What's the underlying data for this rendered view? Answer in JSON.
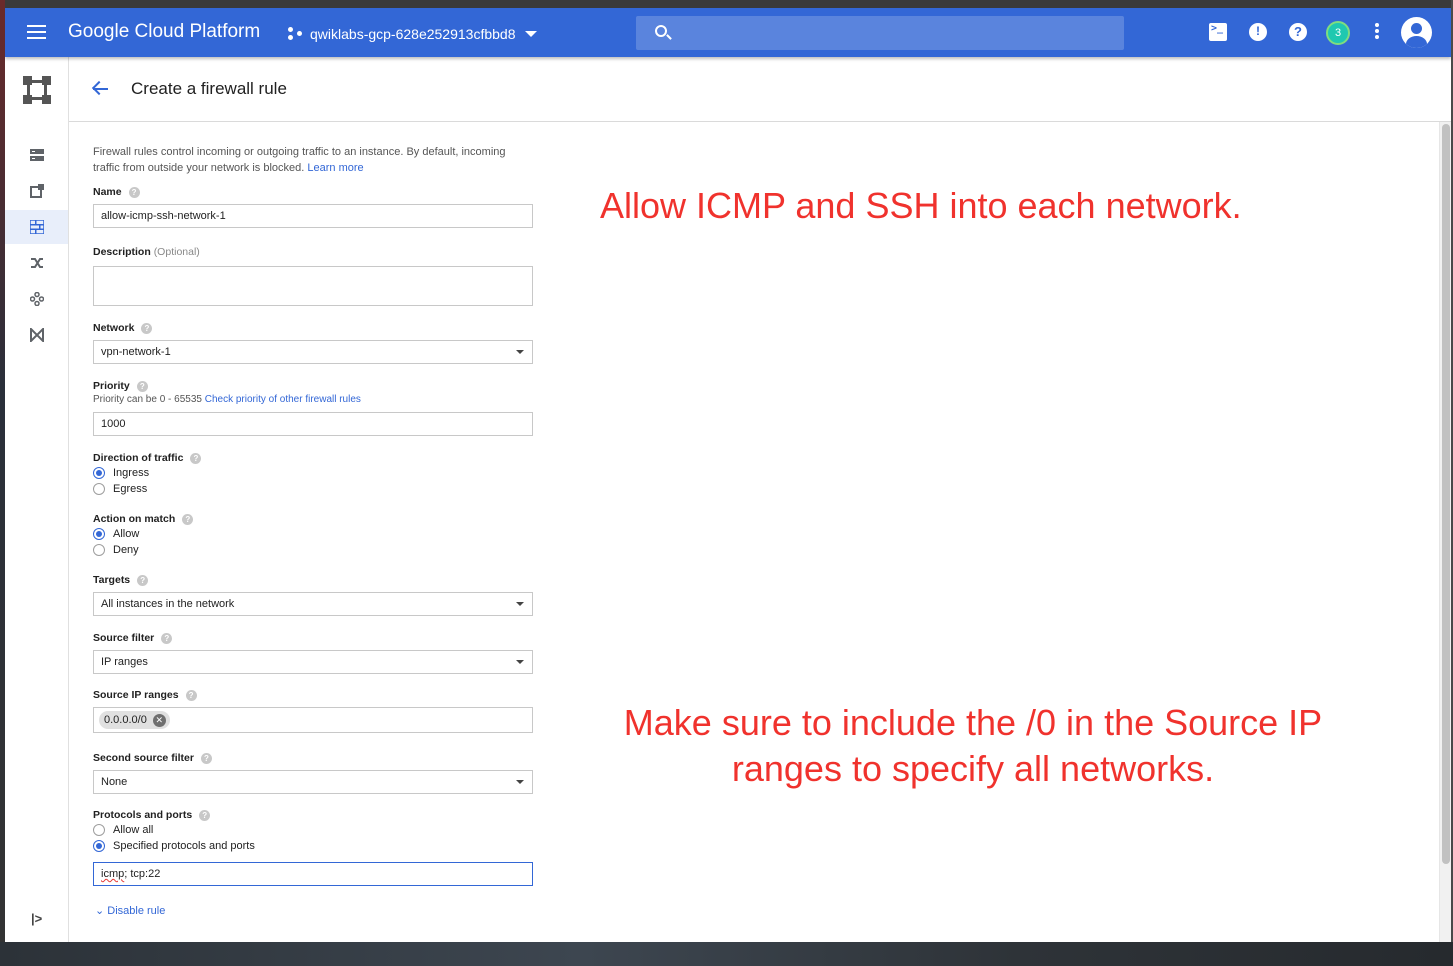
{
  "topbar": {
    "brand": "Google Cloud Platform",
    "project": "qwiklabs-gcp-628e252913cfbbd8",
    "notification_count": "3",
    "color": "#3367d6"
  },
  "page": {
    "title": "Create a firewall rule"
  },
  "form": {
    "intro": "Firewall rules control incoming or outgoing traffic to an instance. By default, incoming traffic from outside your network is blocked.",
    "learn_more": "Learn more",
    "name_label": "Name",
    "name_value": "allow-icmp-ssh-network-1",
    "description_label": "Description",
    "description_optional": "(Optional)",
    "description_value": "",
    "network_label": "Network",
    "network_value": "vpn-network-1",
    "priority_label": "Priority",
    "priority_hint": "Priority can be 0 - 65535",
    "priority_link": "Check priority of other firewall rules",
    "priority_value": "1000",
    "direction_label": "Direction of traffic",
    "direction_options": [
      "Ingress",
      "Egress"
    ],
    "direction_selected": "Ingress",
    "action_label": "Action on match",
    "action_options": [
      "Allow",
      "Deny"
    ],
    "action_selected": "Allow",
    "targets_label": "Targets",
    "targets_value": "All instances in the network",
    "source_filter_label": "Source filter",
    "source_filter_value": "IP ranges",
    "source_ip_label": "Source IP ranges",
    "source_ip_chip": "0.0.0.0/0",
    "second_source_label": "Second source filter",
    "second_source_value": "None",
    "protocols_label": "Protocols and ports",
    "protocols_options": [
      "Allow all",
      "Specified protocols and ports"
    ],
    "protocols_selected": "Specified protocols and ports",
    "protocols_value_word": "icmp",
    "protocols_value_rest": "; tcp:22",
    "disable_rule": "Disable rule"
  },
  "annotations": {
    "top": "Allow ICMP and SSH into each network.",
    "bottom": "Make sure to include the /0 in the Source IP ranges to specify all networks.",
    "color": "#f0322d"
  }
}
